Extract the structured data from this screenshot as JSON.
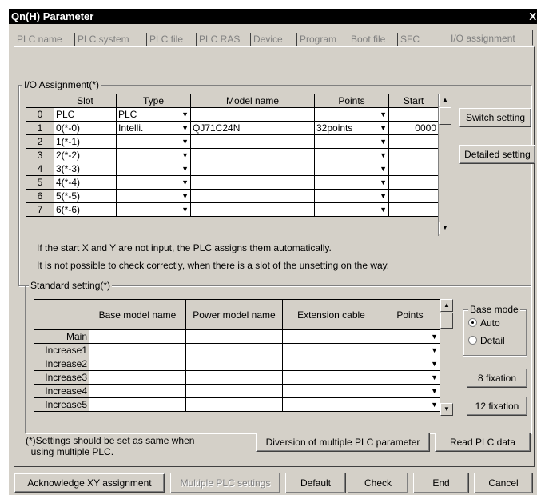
{
  "window": {
    "title": "Qn(H) Parameter",
    "close": "X"
  },
  "tabs": [
    "PLC name",
    "PLC system",
    "PLC file",
    "PLC RAS",
    "Device",
    "Program",
    "Boot file",
    "SFC",
    "I/O assignment"
  ],
  "io": {
    "group_label": "I/O Assignment(*)",
    "headers": [
      "Slot",
      "Type",
      "Model name",
      "Points",
      "Start"
    ],
    "rows": [
      {
        "no": "0",
        "slot": "PLC",
        "type": "PLC",
        "model": "",
        "points": "",
        "start": ""
      },
      {
        "no": "1",
        "slot": "0(*-0)",
        "type": "Intelli.",
        "model": "QJ71C24N",
        "points": "32points",
        "start": "0000"
      },
      {
        "no": "2",
        "slot": "1(*-1)",
        "type": "",
        "model": "",
        "points": "",
        "start": ""
      },
      {
        "no": "3",
        "slot": "2(*-2)",
        "type": "",
        "model": "",
        "points": "",
        "start": ""
      },
      {
        "no": "4",
        "slot": "3(*-3)",
        "type": "",
        "model": "",
        "points": "",
        "start": ""
      },
      {
        "no": "5",
        "slot": "4(*-4)",
        "type": "",
        "model": "",
        "points": "",
        "start": ""
      },
      {
        "no": "6",
        "slot": "5(*-5)",
        "type": "",
        "model": "",
        "points": "",
        "start": ""
      },
      {
        "no": "7",
        "slot": "6(*-6)",
        "type": "",
        "model": "",
        "points": "",
        "start": ""
      }
    ],
    "switch_setting": "Switch setting",
    "detailed_setting": "Detailed setting",
    "note1": "If the start X and Y are not input, the PLC assigns them automatically.",
    "note2": "It is not possible to check correctly, when there is a slot of the unsetting on the way."
  },
  "standard": {
    "group_label": "Standard setting(*)",
    "headers": [
      "",
      "Base model name",
      "Power model name",
      "Extension cable",
      "Points"
    ],
    "rows": [
      "Main",
      "Increase1",
      "Increase2",
      "Increase3",
      "Increase4",
      "Increase5"
    ],
    "base_mode_label": "Base mode",
    "radio_auto": "Auto",
    "radio_detail": "Detail",
    "radio_selected": "Auto",
    "fix8": "8 fixation",
    "fix12": "12 fixation"
  },
  "footer_note": "(*)Settings should be set as same when\n  using multiple PLC.",
  "diversion": "Diversion of multiple PLC parameter",
  "read_plc": "Read PLC data",
  "bottom": {
    "ack": "Acknowledge XY assignment",
    "multiple": "Multiple PLC settings",
    "default": "Default",
    "check": "Check",
    "end": "End",
    "cancel": "Cancel"
  }
}
